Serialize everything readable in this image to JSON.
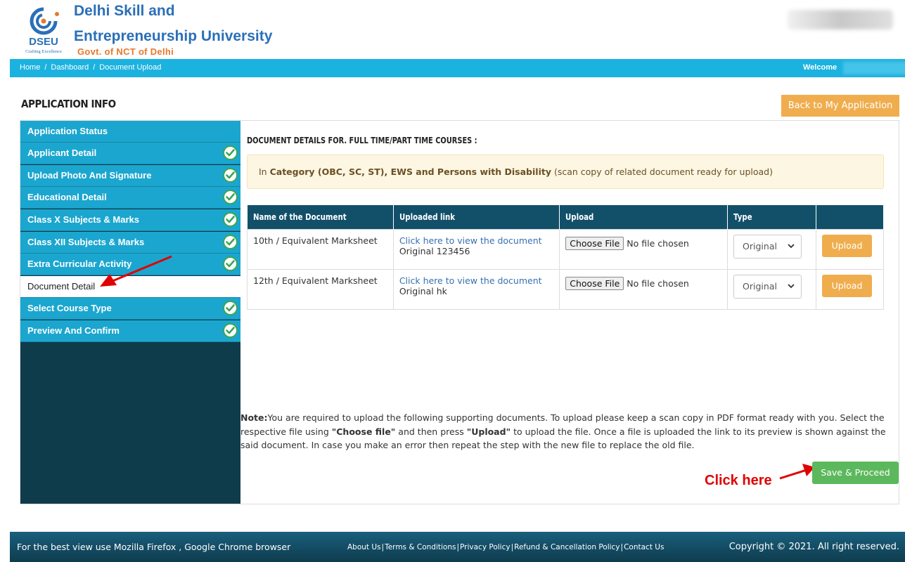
{
  "header": {
    "logo_text": "DSEU",
    "logo_tagline": "Crafting Excellence",
    "name_line1": "Delhi Skill and",
    "name_line2": "Entrepreneurship University",
    "govt": "Govt. of NCT of Delhi"
  },
  "nav": {
    "breadcrumb": [
      "Home",
      "Dashboard",
      "Document Upload"
    ],
    "welcome": "Welcome"
  },
  "page": {
    "title": "APPLICATION INFO",
    "back_button": "Back to My Application"
  },
  "sidebar": {
    "items": [
      {
        "label": "Application Status",
        "checked": false,
        "active": false
      },
      {
        "label": "Applicant Detail",
        "checked": true,
        "active": false
      },
      {
        "label": "Upload Photo And Signature",
        "checked": true,
        "active": false
      },
      {
        "label": "Educational Detail",
        "checked": true,
        "active": false
      },
      {
        "label": "Class X Subjects & Marks",
        "checked": true,
        "active": false
      },
      {
        "label": "Class XII Subjects & Marks",
        "checked": true,
        "active": false
      },
      {
        "label": "Extra Curricular Activity",
        "checked": true,
        "active": false
      },
      {
        "label": "Document Detail",
        "checked": false,
        "active": true
      },
      {
        "label": "Select Course Type",
        "checked": true,
        "active": false
      },
      {
        "label": "Preview And Confirm",
        "checked": true,
        "active": false
      }
    ]
  },
  "content": {
    "heading": "DOCUMENT DETAILS FOR. FULL TIME/PART TIME COURSES :",
    "alert_pre": "In ",
    "alert_bold": "Category (OBC, SC, ST), EWS and Persons with Disability",
    "alert_post": " (scan copy of related document ready for upload)",
    "table": {
      "headers": [
        "Name of the Document",
        "Uploaded link",
        "Upload",
        "Type",
        ""
      ],
      "rows": [
        {
          "name": "10th / Equivalent Marksheet",
          "link": "Click here to view the document",
          "original": "Original 123456",
          "file_button": "Choose File",
          "file_text": "No file chosen",
          "type": "Original",
          "upload": "Upload"
        },
        {
          "name": "12th / Equivalent Marksheet",
          "link": "Click here to view the document",
          "original": "Original hk",
          "file_button": "Choose File",
          "file_text": "No file chosen",
          "type": "Original",
          "upload": "Upload"
        }
      ]
    },
    "note": {
      "label": "Note:",
      "t1": "You are required to upload the following supporting documents. To upload please keep a scan copy in PDF format ready with you. Select the respective file using ",
      "b1": "\"Choose file\"",
      "t2": " and then press ",
      "b2": "\"Upload\"",
      "t3": " to upload the file. Once a file is uploaded the link to its preview is shown against the said document. In case you make an error then repeat the step with the new file to replace the old file."
    },
    "click_here": "Click here",
    "save_button": "Save & Proceed"
  },
  "footer": {
    "left": "For the best view use Mozilla Firefox , Google Chrome browser",
    "links": [
      "About Us",
      "Terms & Conditions",
      "Privacy Policy",
      "Refund & Cancellation Policy",
      "Contact Us"
    ],
    "right": "Copyright © 2021. All right reserved."
  },
  "colors": {
    "nav": "#1cb2df",
    "sidebar_item": "#1ba6cf",
    "sidebar_bg": "#0f3c4a",
    "table_header": "#12506a",
    "warning_button": "#f0ad4e",
    "success_button": "#5cb85c",
    "annotation": "#e00000"
  }
}
